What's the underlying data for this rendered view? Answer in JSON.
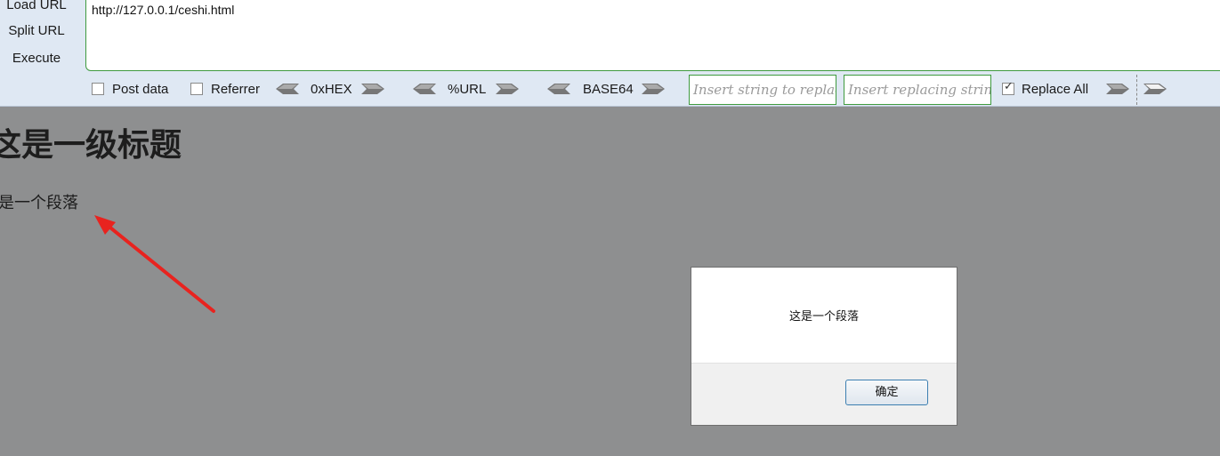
{
  "hackbar": {
    "side_buttons": {
      "load_url": "Load URL",
      "split_url": "Split URL",
      "execute": "Execute"
    },
    "url_value": "http://127.0.0.1/ceshi.html",
    "post_data_label": "Post data",
    "referrer_label": "Referrer",
    "hex_label": "0xHEX",
    "url_encode_label": "%URL",
    "base64_label": "BASE64",
    "replace_find_placeholder": "Insert string to replace",
    "replace_with_placeholder": "Insert replacing string",
    "replace_all_label": "Replace All",
    "replace_all_checked": true,
    "post_data_checked": false,
    "referrer_checked": false
  },
  "page": {
    "heading": "这是一级标题",
    "paragraph": "这是一个段落"
  },
  "dialog": {
    "message": "这是一个段落",
    "ok_label": "确定"
  },
  "colors": {
    "overlay": "#8e8f90",
    "toolbar_bg": "#dfe8f3",
    "input_border": "#3f9a3f",
    "annotation_arrow": "#e8231f"
  }
}
